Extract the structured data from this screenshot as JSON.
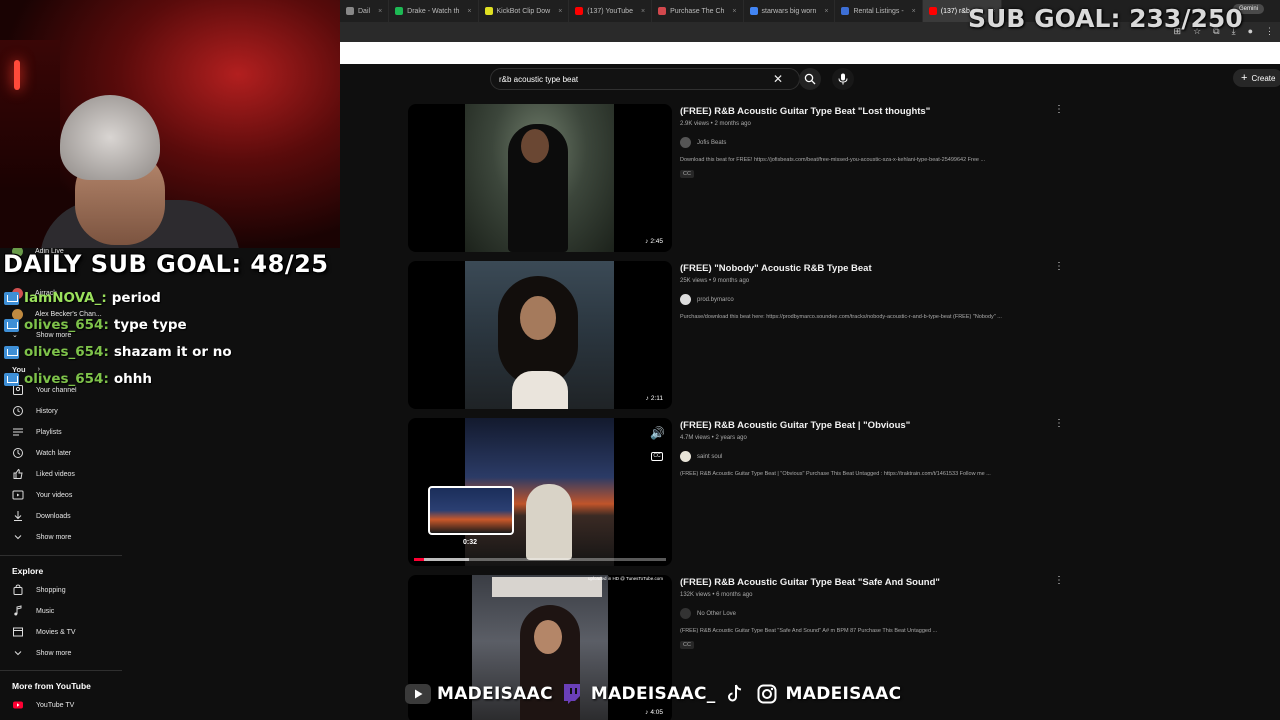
{
  "browser": {
    "tabs": [
      {
        "label": "Dail",
        "color": "#888888",
        "active": false
      },
      {
        "label": "Drake - Watch th",
        "color": "#1db954",
        "active": false
      },
      {
        "label": "KickBot Clip Dow",
        "color": "#e0e022",
        "active": false
      },
      {
        "label": "(137) YouTube",
        "color": "#ff0000",
        "active": false
      },
      {
        "label": "Purchase The Ch",
        "color": "#d2484d",
        "active": false
      },
      {
        "label": "starwars big worn",
        "color": "#4285f4",
        "active": false
      },
      {
        "label": "Rental Listings -",
        "color": "#3d6fd6",
        "active": false
      },
      {
        "label": "(137) r&b aco",
        "color": "#ff0000",
        "active": true
      }
    ],
    "gemini_label": "Gemini"
  },
  "overlay": {
    "top_goal": "SUB GOAL: 233/250",
    "daily_goal": "DAILY SUB GOAL: 48/25",
    "social_handles": [
      "MADEISAAC",
      "MADEISAAC_",
      "MADEISAAC"
    ]
  },
  "chat": [
    {
      "user": "IamNOVA_:",
      "color": "#9be15d",
      "msg": "period"
    },
    {
      "user": "olives_654:",
      "color": "#7ec24a",
      "msg": "type type"
    },
    {
      "user": "olives_654:",
      "color": "#7ec24a",
      "msg": "shazam it or no"
    },
    {
      "user": "olives_654:",
      "color": "#7ec24a",
      "msg": "ohhh"
    }
  ],
  "header": {
    "search_value": "r&b acoustic type beat",
    "create_label": "Create"
  },
  "sidebar": {
    "subscriptions": [
      "Adin Live",
      "Airrack",
      "Alex Becker's Chan..."
    ],
    "show_more": "Show more",
    "you_label": "You",
    "you_items": [
      "Your channel",
      "History",
      "Playlists",
      "Watch later",
      "Liked videos",
      "Your videos",
      "Downloads",
      "Show more"
    ],
    "explore_label": "Explore",
    "explore_items": [
      "Shopping",
      "Music",
      "Movies & TV",
      "Show more"
    ],
    "more_label": "More from YouTube",
    "more_items": [
      "YouTube TV"
    ]
  },
  "results": [
    {
      "title": "(FREE) R&B Acoustic Guitar Type Beat \"Lost thoughts\"",
      "meta": "2.9K views • 2 months ago",
      "channel": "Jofis Beats",
      "desc": "Download this beat for FREE! https://jofisbeats.com/beat/free-missed-you-acoustic-sza-x-kehlani-type-beat-25499642 Free ...",
      "cc": "CC",
      "duration": "2:45"
    },
    {
      "title": "(FREE) \"Nobody\" Acoustic R&B Type Beat",
      "meta": "25K views • 9 months ago",
      "channel": "prod.bymarco",
      "desc": "Purchase/download this beat here: https://prodbymarco.soundee.com/tracks/nobody-acoustic-r-and-b-type-beat (FREE) \"Nobody\" ...",
      "cc": "",
      "duration": "2:11"
    },
    {
      "title": "(FREE) R&B Acoustic Guitar Type Beat | \"Obvious\"",
      "meta": "4.7M views • 2 years ago",
      "channel": "saint soul",
      "desc": "(FREE) R&B Acoustic Guitar Type Beat | \"Obvious\" Purchase This Beat Untagged : https://traktrain.com/t/1461533 Follow me ...",
      "cc": "",
      "duration": "",
      "scrub_time": "0:32",
      "watermark": "uploaded in HD @ TunesToTube.com",
      "progress": 0.04,
      "buffered": 0.22
    },
    {
      "title": "(FREE) R&B Acoustic Guitar Type Beat \"Safe And Sound\"",
      "meta": "132K views • 6 months ago",
      "channel": "No Other Love",
      "desc": "(FREE) R&B Acoustic Guitar Type Beat \"Safe And Sound\" A# m BPM 87 Purchase This Beat Untagged ...",
      "cc": "CC",
      "duration": "4:05"
    }
  ]
}
